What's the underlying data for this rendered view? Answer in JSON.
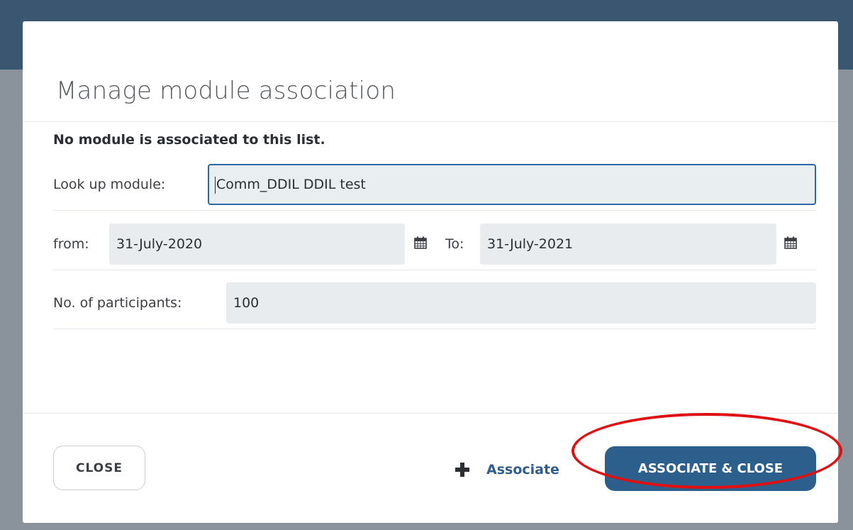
{
  "dialog": {
    "title": "Manage module association",
    "notice": "No module is associated to this list."
  },
  "form": {
    "lookup": {
      "label": "Look up module:",
      "value": "Comm_DDIL DDIL test"
    },
    "from": {
      "label": "from:",
      "value": "31-July-2020"
    },
    "to": {
      "label": "To:",
      "value": "31-July-2021"
    },
    "participants": {
      "label": "No. of participants:",
      "value": "100"
    }
  },
  "footer": {
    "close_label": "CLOSE",
    "associate_label": "Associate",
    "associate_close_label": "ASSOCIATE & CLOSE"
  },
  "icons": {
    "calendar": "calendar-icon",
    "plus": "plus-icon"
  },
  "colors": {
    "primary": "#2d5f8d",
    "link": "#2f5e8e",
    "focus_border": "#2f67a6",
    "annotation": "#e01010"
  }
}
